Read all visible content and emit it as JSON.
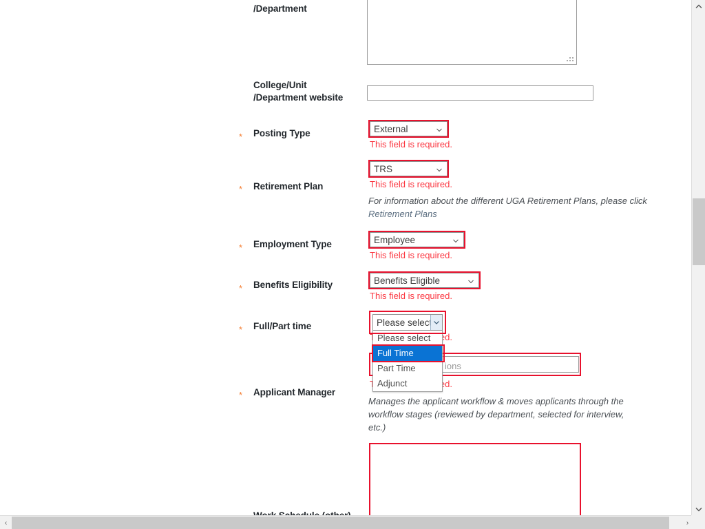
{
  "form": {
    "fields": [
      {
        "label": "/Department",
        "required": false,
        "control": "textarea",
        "value": ""
      },
      {
        "label": "College/Unit\n/Department website",
        "required": false,
        "control": "text",
        "value": ""
      },
      {
        "label": "Posting Type",
        "required": true,
        "control": "select",
        "value": "External",
        "error": "This field is required."
      },
      {
        "label": "Retirement Plan",
        "required": true,
        "control": "select",
        "value": "TRS",
        "error": "This field is required.",
        "hint_text": "For information about the different UGA Retirement Plans, please click ",
        "hint_link": "Retirement Plans"
      },
      {
        "label": "Employment Type",
        "required": true,
        "control": "select",
        "value": "Employee",
        "error": "This field is required."
      },
      {
        "label": "Benefits Eligibility",
        "required": true,
        "control": "select",
        "value": "Benefits Eligible",
        "error": "This field is required."
      },
      {
        "label": "Full/Part time",
        "required": true,
        "control": "select-open",
        "value": "Please select",
        "error": "This field is required.",
        "options": [
          "Please select",
          "Full Time",
          "Part Time",
          "Adjunct"
        ],
        "highlighted_option": "Full Time"
      },
      {
        "label": "Applicant Manager",
        "required": true,
        "control": "autocomplete",
        "value": "",
        "placeholder_tail": "ions",
        "error": "This field is required.",
        "hint_text": "Manages the applicant workflow & moves applicants through the workflow stages (reviewed by department, selected for interview, etc.)"
      },
      {
        "label": "Work Schedule (other)",
        "required": false,
        "control": "textarea",
        "value": ""
      }
    ],
    "required_marker": "*"
  },
  "colors": {
    "required_star": "#f47d31",
    "error_text": "#fb3640",
    "error_border": "#e8112d",
    "highlight_blue": "#0a73d4",
    "label_text": "#23282d"
  },
  "scrollbars": {
    "v_up": "▴",
    "v_down": "▾",
    "h_left": "‹",
    "h_right": "›"
  }
}
